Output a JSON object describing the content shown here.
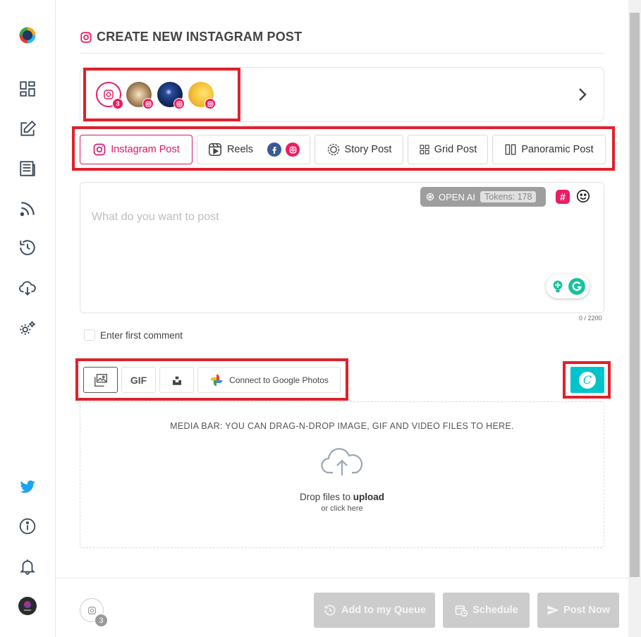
{
  "page": {
    "title": "CREATE NEW INSTAGRAM POST"
  },
  "accounts": {
    "selected_count": "3"
  },
  "post_types": [
    {
      "label": "Instagram Post",
      "active": true
    },
    {
      "label": "Reels",
      "active": false
    },
    {
      "label": "Story Post",
      "active": false
    },
    {
      "label": "Grid Post",
      "active": false
    },
    {
      "label": "Panoramic Post",
      "active": false
    }
  ],
  "composer": {
    "placeholder": "What do you want to post",
    "openai_label": "OPEN AI",
    "tokens_label": "Tokens: 178",
    "hashtag_symbol": "#",
    "char_count": "0 / 2200"
  },
  "first_comment": {
    "label": "Enter first comment"
  },
  "media_toolbar": {
    "gif_label": "GIF",
    "google_photos_label": "Connect to Google Photos"
  },
  "dropzone": {
    "title": "MEDIA BAR: YOU CAN DRAG-N-DROP IMAGE, GIF AND VIDEO FILES TO HERE.",
    "main_prefix": "Drop files to ",
    "main_bold": "upload",
    "sub": "or click here"
  },
  "footer": {
    "account_count": "3",
    "queue_label": "Add to my Queue",
    "schedule_label": "Schedule",
    "post_now_label": "Post Now"
  },
  "colors": {
    "instagram_pink": "#e91e63",
    "highlight_red": "#e0212b",
    "canva_teal": "#00c4cc",
    "twitter_blue": "#1da1f2",
    "disabled_grey": "#cccccc"
  }
}
